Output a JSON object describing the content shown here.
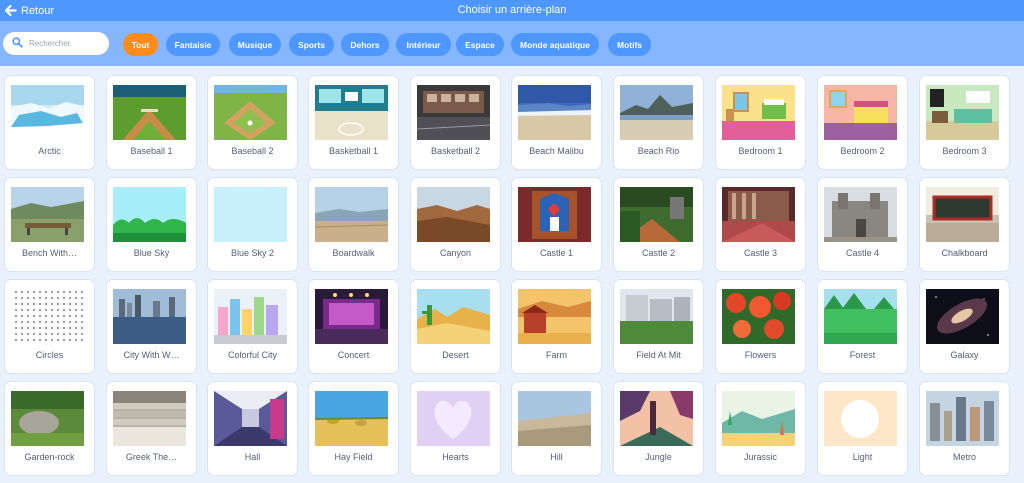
{
  "header": {
    "back_label": "Retour",
    "title": "Choisir un arrière-plan"
  },
  "search": {
    "placeholder": "Rechercher",
    "value": ""
  },
  "tags": [
    {
      "label": "Tout",
      "active": true
    },
    {
      "label": "Fantaisie",
      "active": false
    },
    {
      "label": "Musique",
      "active": false
    },
    {
      "label": "Sports",
      "active": false
    },
    {
      "label": "Dehors",
      "active": false
    },
    {
      "label": "Intérieur",
      "active": false
    },
    {
      "label": "Espace",
      "active": false
    },
    {
      "label": "Monde aquatique",
      "active": false
    },
    {
      "label": "Motifs",
      "active": false
    }
  ],
  "colors": {
    "header": "#4d97ff",
    "filter_bar": "#85b6ff",
    "active_tag": "#ff8c1a",
    "tag": "#4d97ff",
    "page_bg": "#e9f1fc"
  },
  "backdrops": [
    {
      "name": "Arctic",
      "art": "arctic"
    },
    {
      "name": "Baseball 1",
      "art": "baseball1"
    },
    {
      "name": "Baseball 2",
      "art": "baseball2"
    },
    {
      "name": "Basketball 1",
      "art": "basketball1"
    },
    {
      "name": "Basketball 2",
      "art": "basketball2"
    },
    {
      "name": "Beach Malibu",
      "art": "beach"
    },
    {
      "name": "Beach Rio",
      "art": "rio"
    },
    {
      "name": "Bedroom 1",
      "art": "bedroom1"
    },
    {
      "name": "Bedroom 2",
      "art": "bedroom2"
    },
    {
      "name": "Bedroom 3",
      "art": "bedroom3"
    },
    {
      "name": "Bench With…",
      "art": "bench"
    },
    {
      "name": "Blue Sky",
      "art": "bluesky"
    },
    {
      "name": "Blue Sky 2",
      "art": "bluesky2"
    },
    {
      "name": "Boardwalk",
      "art": "boardwalk"
    },
    {
      "name": "Canyon",
      "art": "canyon"
    },
    {
      "name": "Castle 1",
      "art": "castle1"
    },
    {
      "name": "Castle 2",
      "art": "castle2"
    },
    {
      "name": "Castle 3",
      "art": "castle3"
    },
    {
      "name": "Castle 4",
      "art": "castle4"
    },
    {
      "name": "Chalkboard",
      "art": "chalkboard"
    },
    {
      "name": "Circles",
      "art": "circles"
    },
    {
      "name": "City With W…",
      "art": "citywater"
    },
    {
      "name": "Colorful City",
      "art": "colorfulcity"
    },
    {
      "name": "Concert",
      "art": "concert"
    },
    {
      "name": "Desert",
      "art": "desert"
    },
    {
      "name": "Farm",
      "art": "farm"
    },
    {
      "name": "Field At Mit",
      "art": "fieldmit"
    },
    {
      "name": "Flowers",
      "art": "flowers"
    },
    {
      "name": "Forest",
      "art": "forest"
    },
    {
      "name": "Galaxy",
      "art": "galaxy"
    },
    {
      "name": "Garden-rock",
      "art": "gardenrock"
    },
    {
      "name": "Greek The…",
      "art": "greek"
    },
    {
      "name": "Hall",
      "art": "hall"
    },
    {
      "name": "Hay Field",
      "art": "hayfield"
    },
    {
      "name": "Hearts",
      "art": "hearts"
    },
    {
      "name": "Hill",
      "art": "hill"
    },
    {
      "name": "Jungle",
      "art": "jungle"
    },
    {
      "name": "Jurassic",
      "art": "jurassic"
    },
    {
      "name": "Light",
      "art": "light"
    },
    {
      "name": "Metro",
      "art": "metro"
    }
  ]
}
